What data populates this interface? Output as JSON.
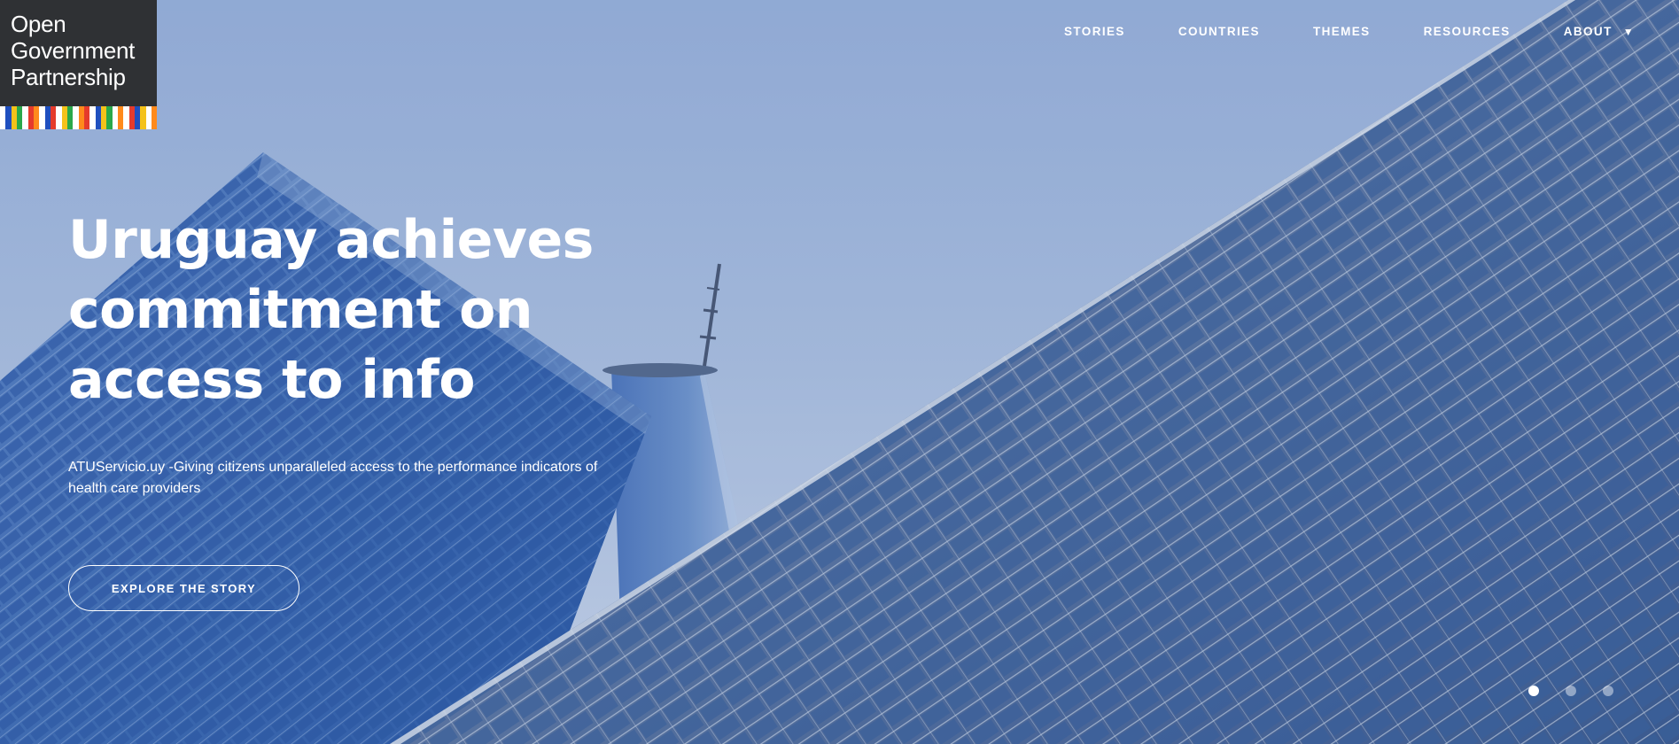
{
  "logo": {
    "lines": [
      "Open",
      "Government",
      "Partnership"
    ],
    "stripe_colors": [
      "#ffffff",
      "#1f4fbf",
      "#f4c21a",
      "#2aa84a",
      "#ffffff",
      "#e53b2c",
      "#ff8a1c",
      "#ffffff",
      "#1f4fbf",
      "#e53b2c",
      "#ffffff",
      "#f4c21a",
      "#2aa84a",
      "#ffffff",
      "#ff8a1c",
      "#e53b2c",
      "#ffffff",
      "#1f4fbf",
      "#f4c21a",
      "#2aa84a",
      "#ffffff",
      "#ff8a1c",
      "#ffffff",
      "#e53b2c",
      "#1f4fbf",
      "#f4c21a",
      "#ffffff",
      "#ff8a1c"
    ]
  },
  "nav": {
    "items": [
      {
        "label": "STORIES"
      },
      {
        "label": "COUNTRIES"
      },
      {
        "label": "THEMES"
      },
      {
        "label": "RESOURCES"
      },
      {
        "label": "ABOUT",
        "caret": "▼"
      }
    ]
  },
  "hero": {
    "headline_lines": [
      "Uruguay achieves",
      "commitment on",
      "access to info"
    ],
    "subtitle": "ATUServicio.uy -Giving citizens unparalleled access to the performance indicators of health care providers",
    "cta_label": "EXPLORE THE STORY",
    "slides": {
      "count": 3,
      "active_index": 0
    }
  }
}
